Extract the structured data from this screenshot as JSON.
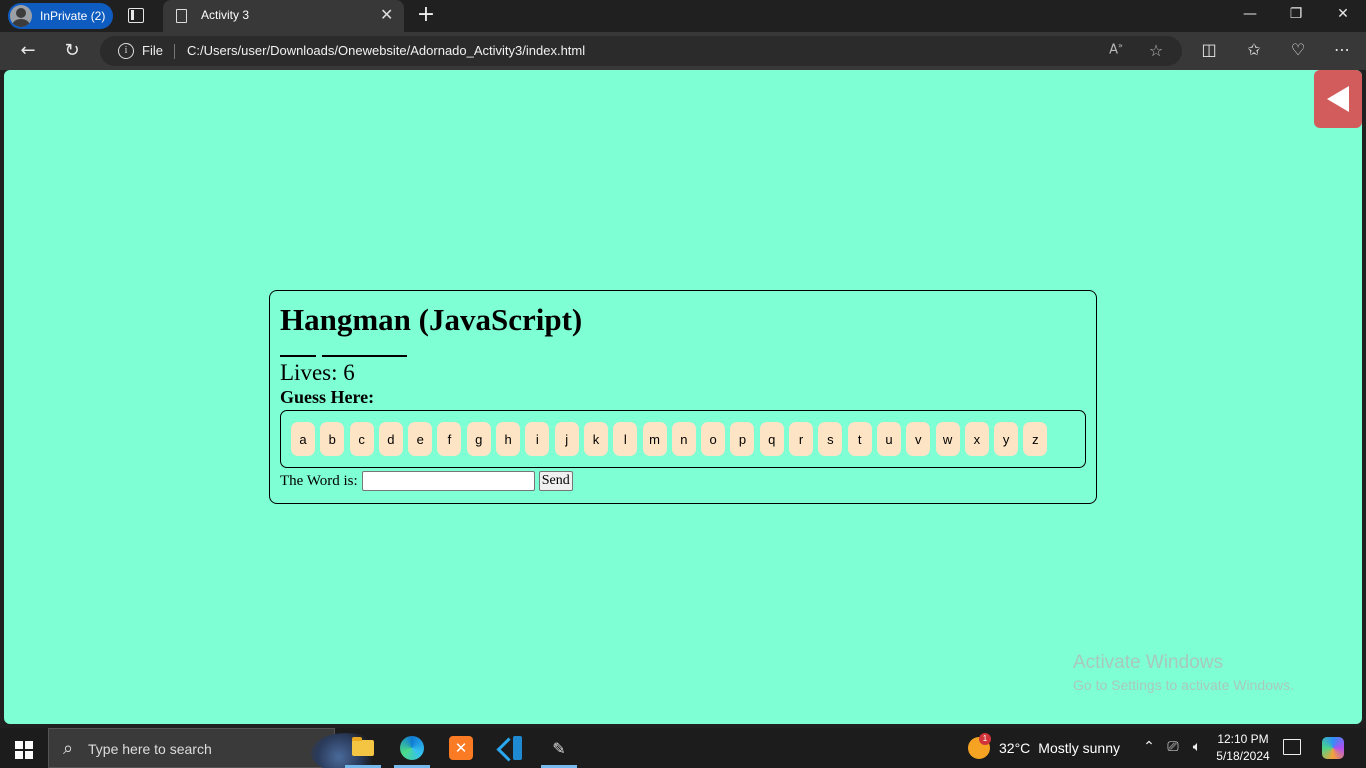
{
  "browser": {
    "profile_label": "InPrivate (2)",
    "tab_title": "Activity 3",
    "new_tab_glyph": "+",
    "address": {
      "scheme_label": "File",
      "url": "C:/Users/user/Downloads/Onewebsite/Adornado_Activity3/index.html"
    },
    "colors": {
      "frame": "#202020",
      "toolbar": "#383838",
      "profile_pill": "#0f5cc0"
    }
  },
  "page": {
    "background": "#7fffd4",
    "sidebar_toggle_color": "#d25c5c",
    "game": {
      "title": "Hangman (JavaScript)",
      "word_blanks": 2,
      "lives_text": "Lives: 6",
      "guess_heading": "Guess Here:",
      "letters": [
        "a",
        "b",
        "c",
        "d",
        "e",
        "f",
        "g",
        "h",
        "i",
        "j",
        "k",
        "l",
        "m",
        "n",
        "o",
        "p",
        "q",
        "r",
        "s",
        "t",
        "u",
        "v",
        "w",
        "x",
        "y",
        "z"
      ],
      "key_color": "#fde4c4",
      "answer_label": "The Word is:",
      "answer_value": "",
      "send_label": "Send"
    },
    "watermark": {
      "line1": "Activate Windows",
      "line2": "Go to Settings to activate Windows."
    }
  },
  "taskbar": {
    "search_placeholder": "Type here to search",
    "apps": [
      "file-explorer-icon",
      "edge-icon",
      "xampp-icon",
      "vscode-icon",
      "pen-icon"
    ],
    "weather": {
      "badge": "1",
      "temp": "32°C",
      "condition": "Mostly sunny"
    },
    "clock": {
      "time": "12:10 PM",
      "date": "5/18/2024"
    },
    "xampp_glyph": "✕"
  }
}
